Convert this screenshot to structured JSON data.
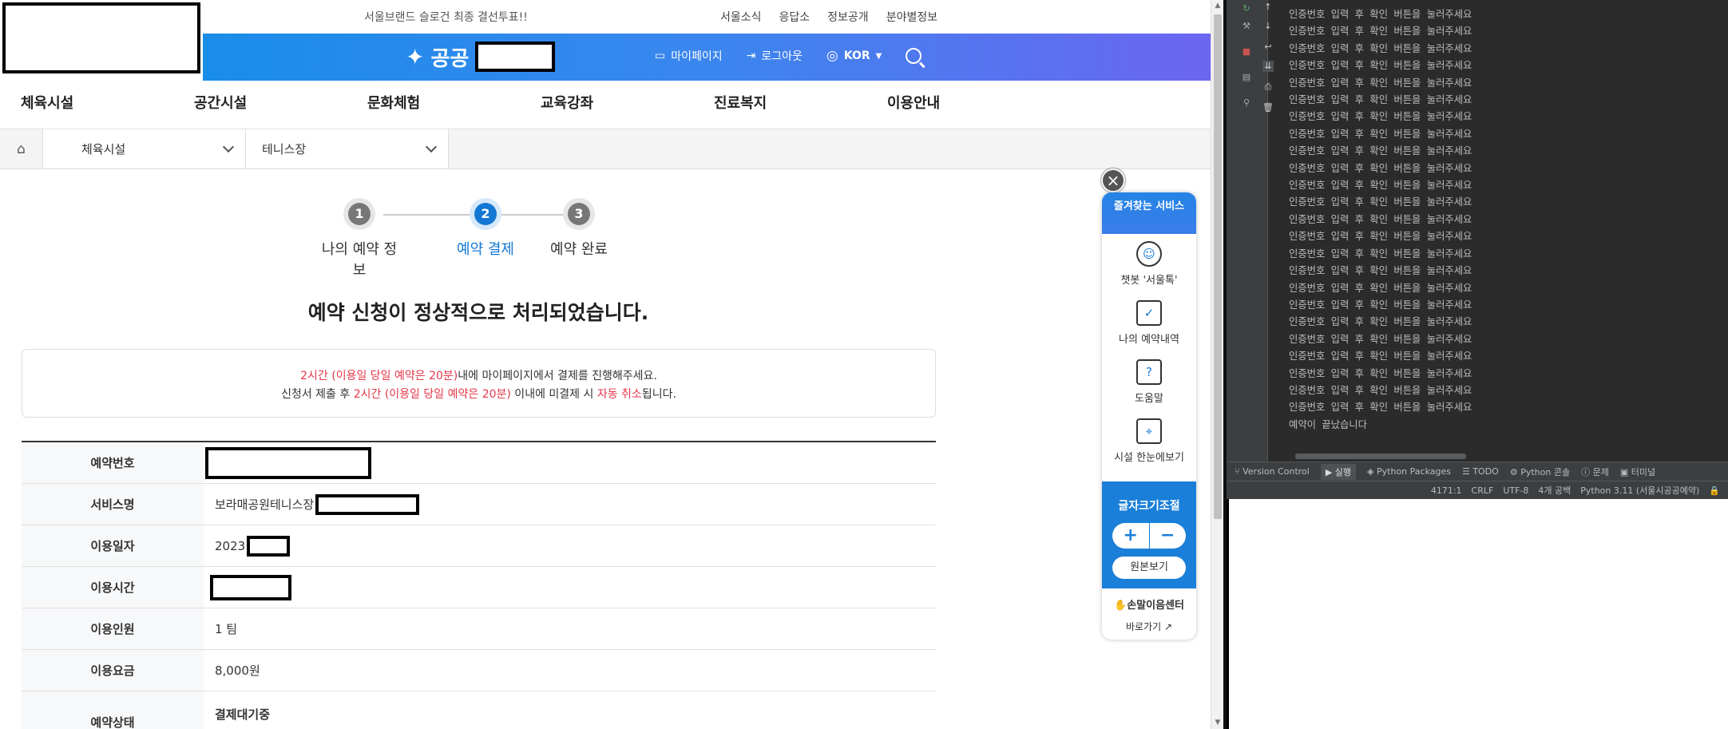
{
  "top": {
    "slogan": "서울브랜드 슬로건 최종 결선투표!!",
    "links": [
      "서울소식",
      "응답소",
      "정보공개",
      "분야별정보"
    ]
  },
  "header": {
    "brand": "공공",
    "mypage": "마이페이지",
    "logout": "로그아웃",
    "lang": "KOR"
  },
  "nav": [
    "체육시설",
    "공간시설",
    "문화체험",
    "교육강좌",
    "진료복지",
    "이용안내"
  ],
  "breadcrumb": {
    "cat1": "체육시설",
    "cat2": "테니스장"
  },
  "steps": [
    {
      "num": "1",
      "label": "나의 예약 정보"
    },
    {
      "num": "2",
      "label": "예약 결제"
    },
    {
      "num": "3",
      "label": "예약 완료"
    }
  ],
  "result_title": "예약 신청이 정상적으로 처리되었습니다.",
  "notice": {
    "l1_red": "2시간 (이용일 당일 예약은 20분)",
    "l1_rest": "내에 마이페이지에서 결제를 진행해주세요.",
    "l2_a": "신청서 제출 후 ",
    "l2_red": "2시간 (이용일 당일 예약은 20분)",
    "l2_b": " 이내에 미결제 시 ",
    "l2_red2": "자동 취소",
    "l2_c": "됩니다."
  },
  "table": {
    "reservation_no": {
      "label": "예약번호"
    },
    "service": {
      "label": "서비스명",
      "value": "보라매공원테니스장"
    },
    "date": {
      "label": "이용일자",
      "value": "2023"
    },
    "time": {
      "label": "이용시간"
    },
    "people": {
      "label": "이용인원",
      "value": "1 팀"
    },
    "fee": {
      "label": "이용요금",
      "value": "8,000원"
    },
    "status": {
      "label": "예약상태",
      "value": "결제대기중"
    }
  },
  "quick": {
    "title": "즐겨찾는 서비스",
    "items": [
      "챗봇 '서울톡'",
      "나의 예약내역",
      "도움말",
      "시설 한눈에보기"
    ],
    "font_title": "글자크기조절",
    "plus": "+",
    "minus": "−",
    "original": "원본보기",
    "sign_center": "손말이음센터",
    "go": "바로가기"
  },
  "ide": {
    "console_line": "인증번호 입력 후 확인 버튼을 눌러주세요",
    "console_end": "예약이 끝났습니다",
    "tabs": [
      "Version Control",
      "실행",
      "Python Packages",
      "TODO",
      "Python 콘솔",
      "문제",
      "터미널"
    ],
    "status": [
      "4171:1",
      "CRLF",
      "UTF-8",
      "4개 공백",
      "Python 3.11 (서울시공공예약)"
    ]
  }
}
